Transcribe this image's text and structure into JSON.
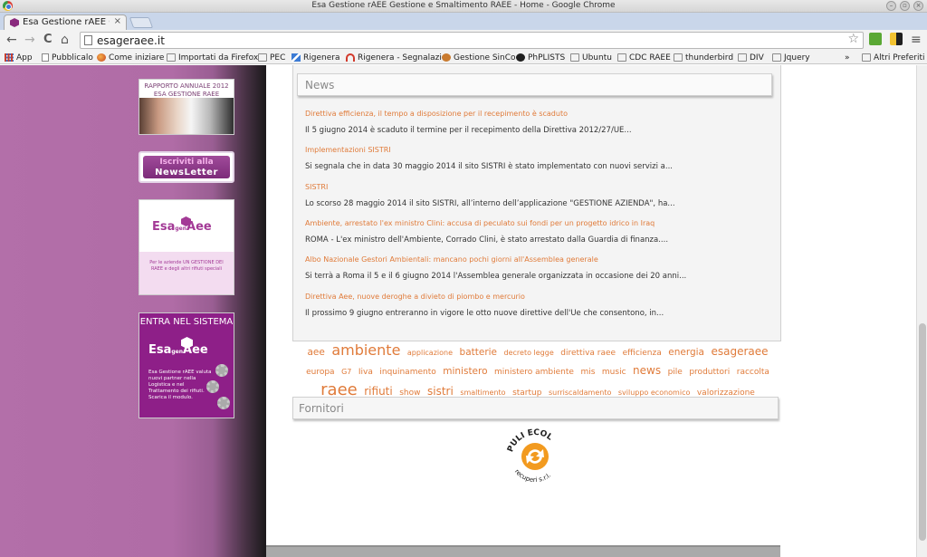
{
  "window": {
    "title": "Esa Gestione rAEE Gestione e Smaltimento RAEE - Home - Google Chrome"
  },
  "tab": {
    "label": "Esa Gestione rAEE Gestio",
    "close": "×"
  },
  "toolbar": {
    "back": "←",
    "forward": "→",
    "reload": "C",
    "home": "⌂",
    "url": "esageraee.it",
    "star": "☆",
    "menu": "≡"
  },
  "bookmarks": [
    {
      "label": "App",
      "icon": "apps-icon"
    },
    {
      "label": "Pubblicalo",
      "icon": "page-icon"
    },
    {
      "label": "Come iniziare",
      "icon": "firefox-icon"
    },
    {
      "label": "Importati da Firefox",
      "icon": "folder-icon"
    },
    {
      "label": "PEC",
      "icon": "folder-icon"
    },
    {
      "label": "Rigenera",
      "icon": "wave-icon"
    },
    {
      "label": "Rigenera - Segnalazio",
      "icon": "arc-icon"
    },
    {
      "label": "Gestione SinCo",
      "icon": "people-icon"
    },
    {
      "label": "PhPLISTS",
      "icon": "php-icon"
    },
    {
      "label": "Ubuntu",
      "icon": "folder-icon"
    },
    {
      "label": "CDC RAEE",
      "icon": "folder-icon"
    },
    {
      "label": "thunderbird",
      "icon": "folder-icon"
    },
    {
      "label": "DIV",
      "icon": "folder-icon"
    },
    {
      "label": "Jquery",
      "icon": "folder-icon"
    }
  ],
  "bookmarks_more": "»",
  "bookmarks_other": "Altri Preferiti",
  "sidebar": {
    "rapporto_line1": "RAPPORTO ANNUALE 2012",
    "rapporto_line2": "ESA GESTIONE RAEE",
    "newsletter_line1": "Iscriviti alla",
    "newsletter_line2": "NewsLetter",
    "esa_logo": "Esa",
    "esa_logo_2": "Aee",
    "esa_small": "Per le aziende UN GESTIONE DEI RAEE e degli altri rifiuti speciali",
    "sistema_head": "ENTRA NEL SISTEMA",
    "sistema_logo": "Esa",
    "sistema_logo_2": "Aee",
    "sistema_text": "Esa Gestione rAEE valuta nuovi partner nella Logistica e nel Trattamento dei rifiuti. Scarica il modulo."
  },
  "news": {
    "header": "News",
    "items": [
      {
        "title": "Direttiva efficienza, il tempo a disposizione per il recepimento è scaduto",
        "body": "Il 5 giugno 2014 è scaduto il termine per il recepimento della Direttiva 2012/27/UE..."
      },
      {
        "title": "Implementazioni SISTRI",
        "body": "Si segnala che in data 30 maggio 2014 il sito SISTRI è stato implementato con nuovi servizi a..."
      },
      {
        "title": "SISTRI",
        "body": "Lo scorso  28 maggio 2014 il sito SISTRI, all’interno dell’applicazione \"GESTIONE AZIENDA\", ha..."
      },
      {
        "title": "Ambiente, arrestato l'ex ministro Clini: accusa di peculato sui fondi per un progetto idrico in Iraq",
        "body": "ROMA - L'ex ministro dell'Ambiente, Corrado Clini, è stato arrestato dalla Guardia di finanza...."
      },
      {
        "title": "Albo Nazionale Gestori Ambientali: mancano pochi giorni all'Assemblea generale",
        "body": "Si terrà a Roma il 5 e il 6 giugno 2014 l'Assemblea generale organizzata in occasione dei 20 anni..."
      },
      {
        "title": "Direttiva Aee, nuove deroghe a divieto di piombo e mercurio",
        "body": "Il prossimo 9 giugno entreranno in vigore le otto nuove direttive dell'Ue che consentono, in..."
      }
    ]
  },
  "tags": [
    {
      "label": "aee",
      "size": "t-m"
    },
    {
      "label": "ambiente",
      "size": "t-xl"
    },
    {
      "label": "applicazione",
      "size": "t-xs"
    },
    {
      "label": "batterie",
      "size": "t-m"
    },
    {
      "label": "decreto legge",
      "size": "t-xs"
    },
    {
      "label": "direttiva raee",
      "size": "t-s"
    },
    {
      "label": "efficienza",
      "size": "t-s"
    },
    {
      "label": "energia",
      "size": "t-m"
    },
    {
      "label": "esageraee",
      "size": "t-l"
    },
    {
      "label": "europa",
      "size": "t-s"
    },
    {
      "label": "G7",
      "size": "t-xs"
    },
    {
      "label": "Iiva",
      "size": "t-s"
    },
    {
      "label": "inquinamento",
      "size": "t-s"
    },
    {
      "label": "ministero",
      "size": "t-m"
    },
    {
      "label": "ministero ambiente",
      "size": "t-s"
    },
    {
      "label": "mis",
      "size": "t-s"
    },
    {
      "label": "music",
      "size": "t-s"
    },
    {
      "label": "news",
      "size": "t-l"
    },
    {
      "label": "pile",
      "size": "t-s"
    },
    {
      "label": "produttori",
      "size": "t-s"
    },
    {
      "label": "raccolta",
      "size": "t-s"
    },
    {
      "label": "raee",
      "size": "t-xxl"
    },
    {
      "label": "rifiuti",
      "size": "t-l"
    },
    {
      "label": "show",
      "size": "t-s"
    },
    {
      "label": "sistri",
      "size": "t-l"
    },
    {
      "label": "smaltimento",
      "size": "t-xs"
    },
    {
      "label": "startup",
      "size": "t-s"
    },
    {
      "label": "surriscaldamento",
      "size": "t-xs"
    },
    {
      "label": "sviluppo economico",
      "size": "t-xs"
    },
    {
      "label": "valorizzazione",
      "size": "t-s"
    }
  ],
  "fornitori": {
    "header": "Fornitori",
    "logo_top": "PULI ECOL",
    "logo_bottom": "recuperi s.r.l."
  },
  "colors": {
    "accent_orange": "#e07b3a",
    "brand_purple": "#8e1f88"
  }
}
